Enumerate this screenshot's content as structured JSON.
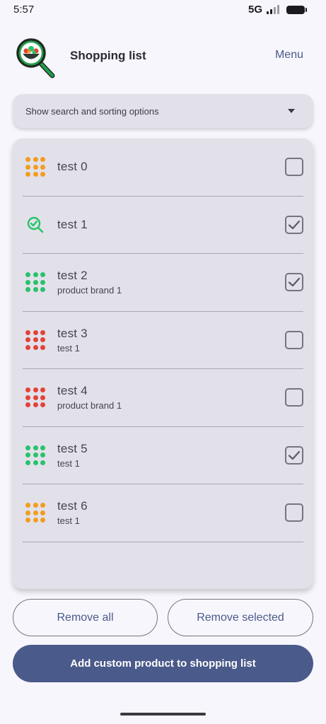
{
  "status_bar": {
    "time": "5:57",
    "network": "5G"
  },
  "header": {
    "title": "Shopping list",
    "menu_label": "Menu",
    "logo_icon": "salad-search-logo-icon"
  },
  "search_toggle": {
    "label": "Show search and sorting options",
    "icon": "dropdown-arrow-icon"
  },
  "colors": {
    "orange": "#f39c1f",
    "green": "#27c36a",
    "red": "#e44236",
    "accent": "#4a5a8a",
    "card_bg": "#e2e1ea"
  },
  "items": [
    {
      "name": "test 0",
      "sub": "",
      "icon": "dots-grid-icon",
      "color": "#f39c1f",
      "checked": false
    },
    {
      "name": "test 1",
      "sub": "",
      "icon": "search-check-icon",
      "color": "#27c36a",
      "checked": true
    },
    {
      "name": "test 2",
      "sub": "product brand 1",
      "icon": "dots-grid-icon",
      "color": "#27c36a",
      "checked": true
    },
    {
      "name": "test 3",
      "sub": "test 1",
      "icon": "dots-grid-icon",
      "color": "#e44236",
      "checked": false
    },
    {
      "name": "test 4",
      "sub": "product brand 1",
      "icon": "dots-grid-icon",
      "color": "#e44236",
      "checked": false
    },
    {
      "name": "test 5",
      "sub": "test 1",
      "icon": "dots-grid-icon",
      "color": "#27c36a",
      "checked": true
    },
    {
      "name": "test 6",
      "sub": "test 1",
      "icon": "dots-grid-icon",
      "color": "#f39c1f",
      "checked": false
    }
  ],
  "buttons": {
    "remove_all": "Remove all",
    "remove_selected": "Remove selected",
    "add_custom": "Add custom product to shopping list"
  }
}
